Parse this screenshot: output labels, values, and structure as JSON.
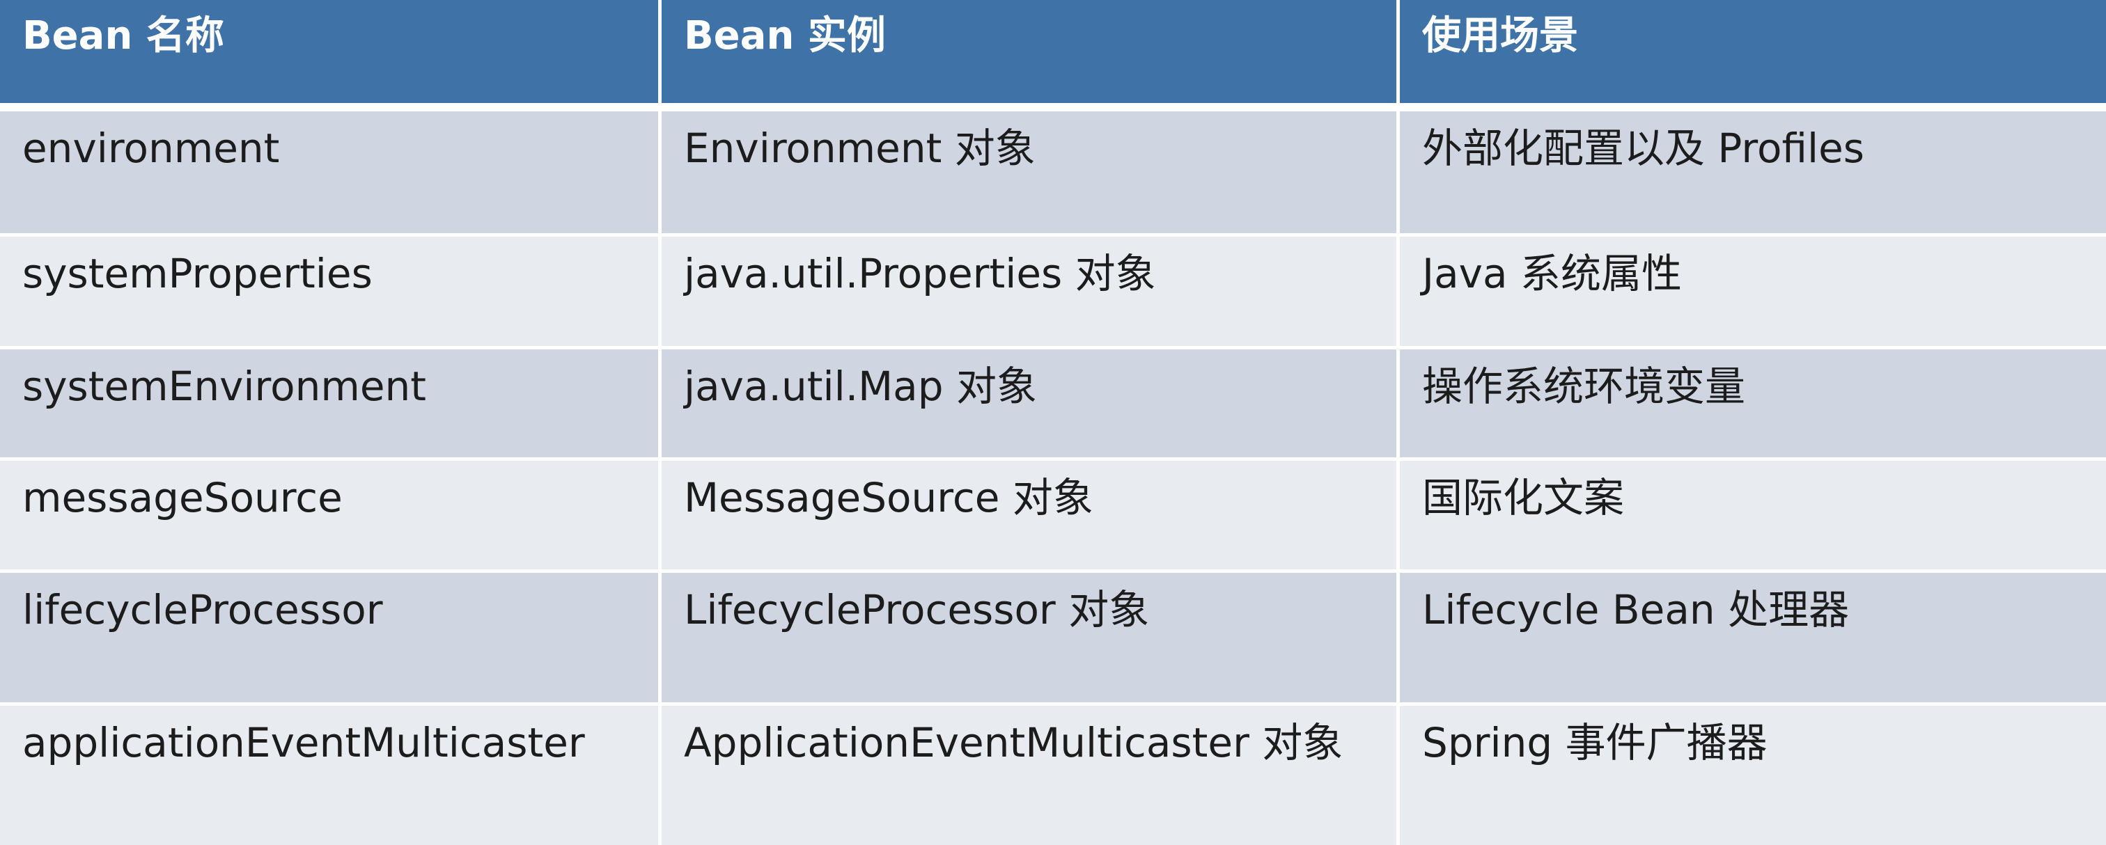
{
  "colors": {
    "header_bg": "#3f73a8",
    "header_text": "#ffffff",
    "row_dark": "#cfd6e2",
    "row_light": "#e8ecf1"
  },
  "table": {
    "headers": [
      "Bean 名称",
      "Bean 实例",
      "使用场景"
    ],
    "rows": [
      [
        "environment",
        "Environment 对象",
        "外部化配置以及 Profiles"
      ],
      [
        "systemProperties",
        "java.util.Properties 对象",
        "Java 系统属性"
      ],
      [
        "systemEnvironment",
        "java.util.Map 对象",
        "操作系统环境变量"
      ],
      [
        "messageSource",
        "MessageSource 对象",
        "国际化文案"
      ],
      [
        "lifecycleProcessor",
        "LifecycleProcessor 对象",
        "Lifecycle Bean 处理器"
      ],
      [
        "applicationEventMulticaster",
        "ApplicationEventMulticaster 对象",
        "Spring 事件广播器"
      ]
    ]
  }
}
